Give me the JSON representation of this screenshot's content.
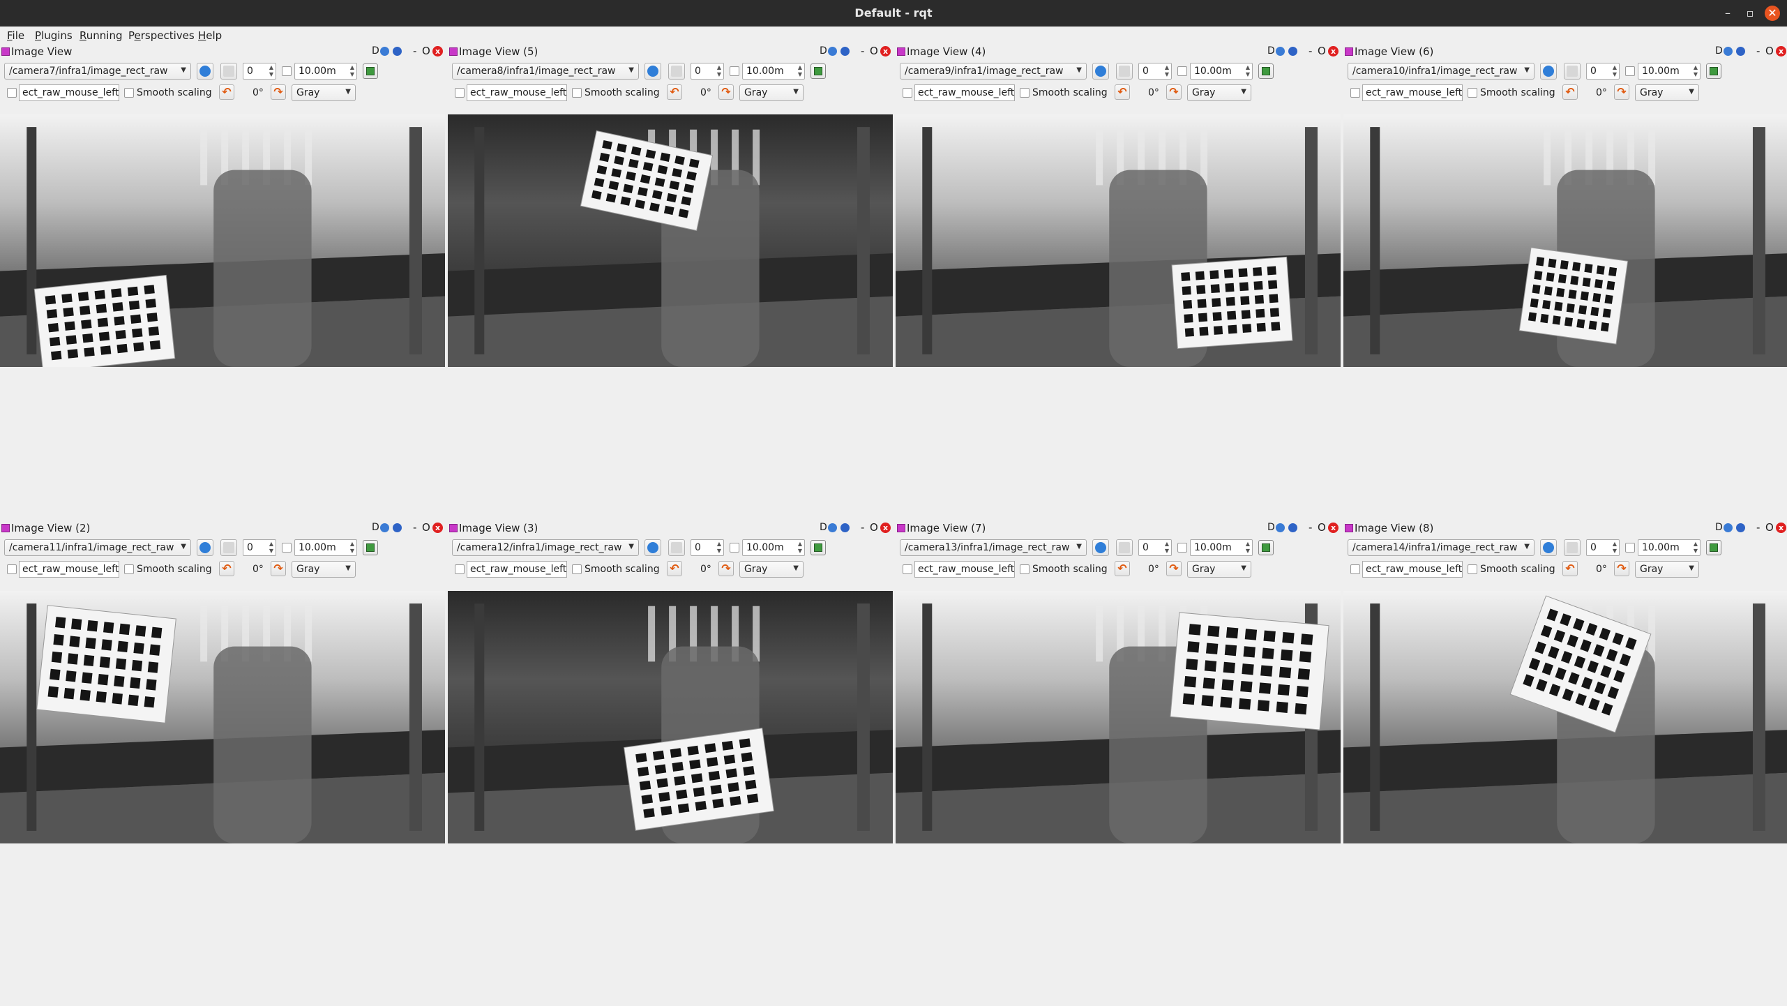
{
  "window": {
    "title": "Default - rqt"
  },
  "menu": [
    {
      "mnemonic": "F",
      "rest": "ile"
    },
    {
      "mnemonic": "P",
      "rest": "lugins"
    },
    {
      "mnemonic": "R",
      "rest": "unning"
    },
    {
      "pre": "P",
      "mnemonic": "e",
      "rest": "rspectives"
    },
    {
      "mnemonic": "H",
      "rest": "elp"
    }
  ],
  "common": {
    "dbutton": "D",
    "minus": "-",
    "undock": "O",
    "close": "x",
    "spin_value": "0",
    "timeout_value": "10.00m",
    "mouse_topic": "ect_raw_mouse_left",
    "smooth_label": "Smooth scaling",
    "rotation": "0°",
    "colormap": "Gray"
  },
  "panels": [
    {
      "title": "Image View",
      "topic": "/camera7/infra1/image_rect_raw"
    },
    {
      "title": "Image View (5)",
      "topic": "/camera8/infra1/image_rect_raw"
    },
    {
      "title": "Image View (4)",
      "topic": "/camera9/infra1/image_rect_raw"
    },
    {
      "title": "Image View (6)",
      "topic": "/camera10/infra1/image_rect_raw"
    },
    {
      "title": "Image View (2)",
      "topic": "/camera11/infra1/image_rect_raw"
    },
    {
      "title": "Image View (3)",
      "topic": "/camera12/infra1/image_rect_raw"
    },
    {
      "title": "Image View (7)",
      "topic": "/camera13/infra1/image_rect_raw"
    },
    {
      "title": "Image View (8)",
      "topic": "/camera14/infra1/image_rect_raw"
    }
  ]
}
